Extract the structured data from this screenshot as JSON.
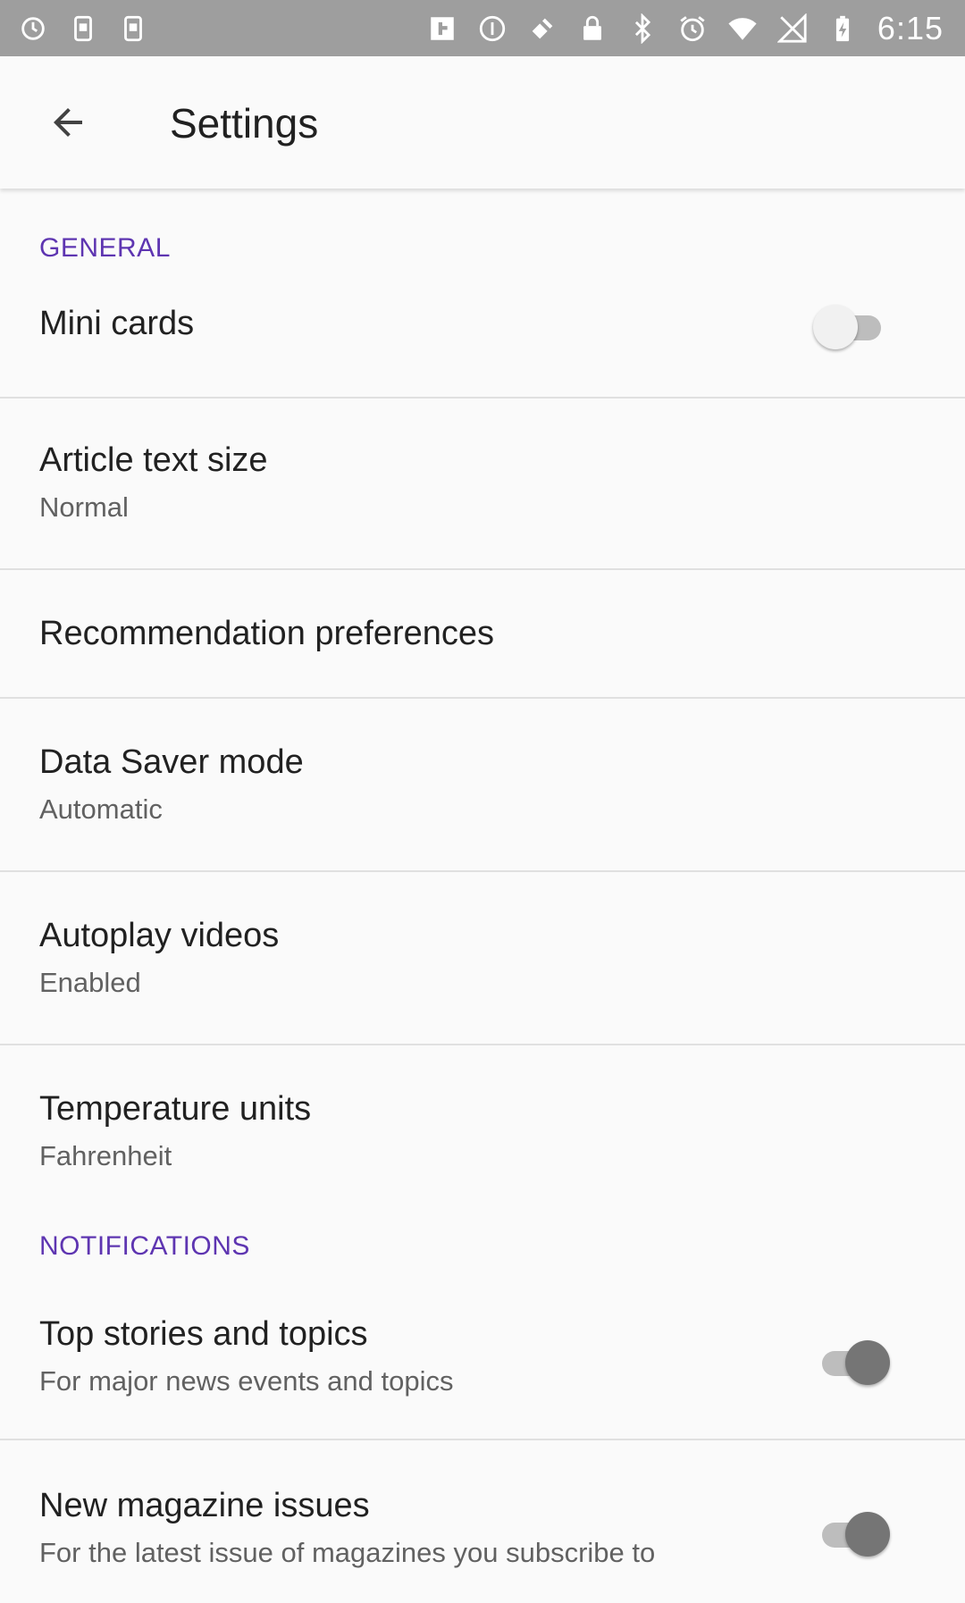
{
  "status_bar": {
    "time": "6:15",
    "icons": [
      "alarm-sync-icon",
      "screenshot-icon",
      "screenshot-icon",
      "flipboard-icon",
      "info-icon",
      "satellite-icon",
      "lock-icon",
      "bluetooth-icon",
      "alarm-icon",
      "wifi-icon",
      "no-signal-icon",
      "battery-charging-icon"
    ]
  },
  "toolbar": {
    "title": "Settings",
    "back_icon": "arrow-back-icon"
  },
  "colors": {
    "accent": "#5e35b1",
    "statusbar": "#9e9e9e",
    "background": "#fafafa"
  },
  "sections": {
    "general": {
      "header": "GENERAL",
      "mini_cards": {
        "title": "Mini cards",
        "enabled": false
      },
      "article_text_size": {
        "title": "Article text size",
        "summary": "Normal"
      },
      "recommendation": {
        "title": "Recommendation preferences"
      },
      "data_saver": {
        "title": "Data Saver mode",
        "summary": "Automatic"
      },
      "autoplay": {
        "title": "Autoplay videos",
        "summary": "Enabled"
      },
      "temperature": {
        "title": "Temperature units",
        "summary": "Fahrenheit"
      }
    },
    "notifications": {
      "header": "NOTIFICATIONS",
      "top_stories": {
        "title": "Top stories and topics",
        "summary": "For major news events and topics",
        "enabled": true
      },
      "magazine": {
        "title": "New magazine issues",
        "summary": "For the latest issue of magazines you subscribe to",
        "enabled": true
      }
    }
  }
}
